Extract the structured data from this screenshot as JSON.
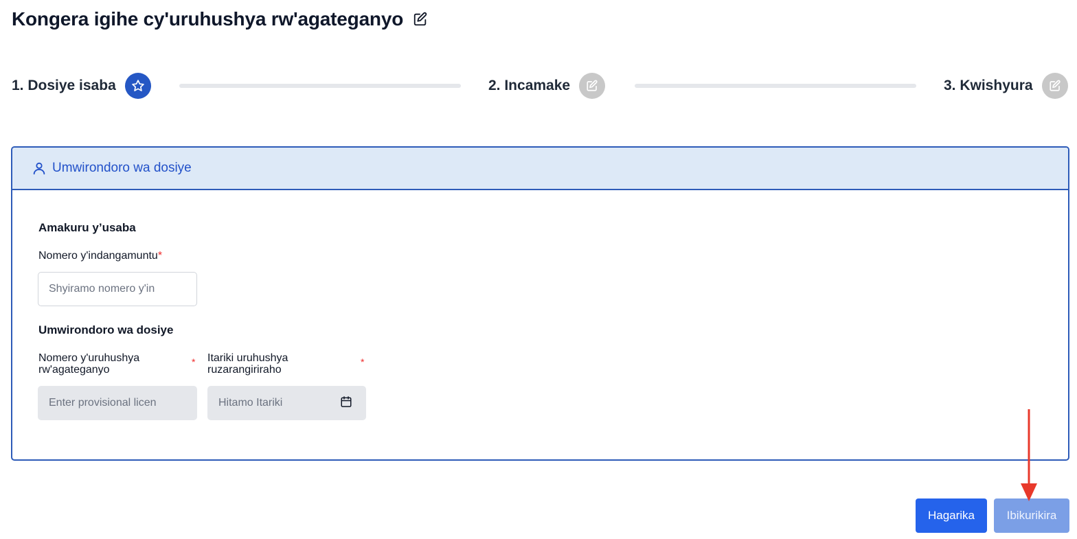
{
  "page": {
    "title": "Kongera igihe cy'uruhushya rw'agateganyo"
  },
  "stepper": {
    "steps": [
      {
        "label": "1. Dosiye isaba",
        "state": "active",
        "icon": "star-icon"
      },
      {
        "label": "2. Incamake",
        "state": "inactive",
        "icon": "edit-icon"
      },
      {
        "label": "3. Kwishyura",
        "state": "inactive",
        "icon": "edit-icon"
      }
    ]
  },
  "card": {
    "header_title": "Umwirondoro wa dosiye",
    "header_icon": "user-icon",
    "applicant_section": {
      "title": "Amakuru y’usaba",
      "id_label": "Nomero y'indangamuntu",
      "id_placeholder": "Shyiramo nomero y'in",
      "required_mark": "*"
    },
    "file_section": {
      "title": "Umwirondoro wa dosiye",
      "license_label_line1": "Nomero y'uruhushya",
      "license_label_line2": "rw'agateganyo",
      "license_placeholder": "Enter provisional licen",
      "date_label_line1": "Itariki uruhushya",
      "date_label_line2": "ruzarangiriraho",
      "date_placeholder": "Hitamo Itariki",
      "date_icon": "calendar-icon",
      "required_mark": "*"
    }
  },
  "actions": {
    "cancel_label": "Hagarika",
    "next_label": "Ibikurikira"
  },
  "colors": {
    "primary": "#2563eb",
    "step_active": "#2557c4",
    "step_inactive": "#c8c8c8",
    "card_border": "#2d5bb8",
    "card_header_bg": "#dde9f7",
    "next_button_disabled": "#7b9fe6",
    "required": "#ef2b2b",
    "annotation_arrow": "#e8392b"
  }
}
